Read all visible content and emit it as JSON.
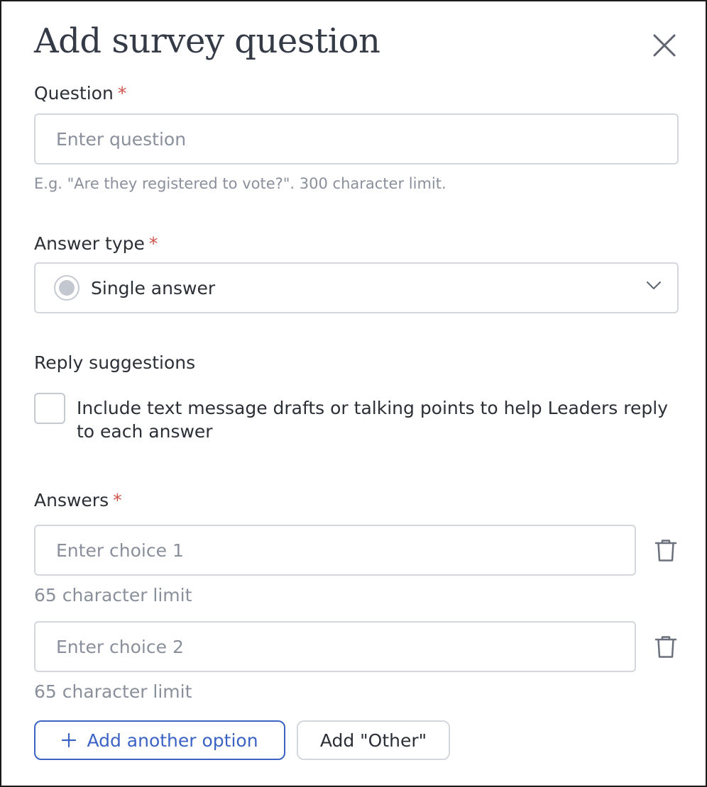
{
  "dialog": {
    "title": "Add survey question",
    "close_label": "Close"
  },
  "question": {
    "label": "Question",
    "required_mark": "*",
    "placeholder": "Enter question",
    "value": "",
    "hint": "E.g. \"Are they registered to vote?\". 300 character limit."
  },
  "answer_type": {
    "label": "Answer type",
    "required_mark": "*",
    "selected": "Single answer"
  },
  "reply_suggestions": {
    "label": "Reply suggestions",
    "checkbox_label": "Include text message drafts or talking points to help Leaders reply to each answer",
    "checked": false
  },
  "answers": {
    "label": "Answers",
    "required_mark": "*",
    "choices": [
      {
        "placeholder": "Enter choice 1",
        "value": "",
        "hint": "65 character limit"
      },
      {
        "placeholder": "Enter choice 2",
        "value": "",
        "hint": "65 character limit"
      }
    ],
    "add_option_label": "Add another option",
    "add_other_label": "Add \"Other\""
  },
  "colors": {
    "required": "#d0504a",
    "accent": "#3b63c4",
    "border": "#d4d7dd",
    "muted_text": "#8a909b"
  }
}
